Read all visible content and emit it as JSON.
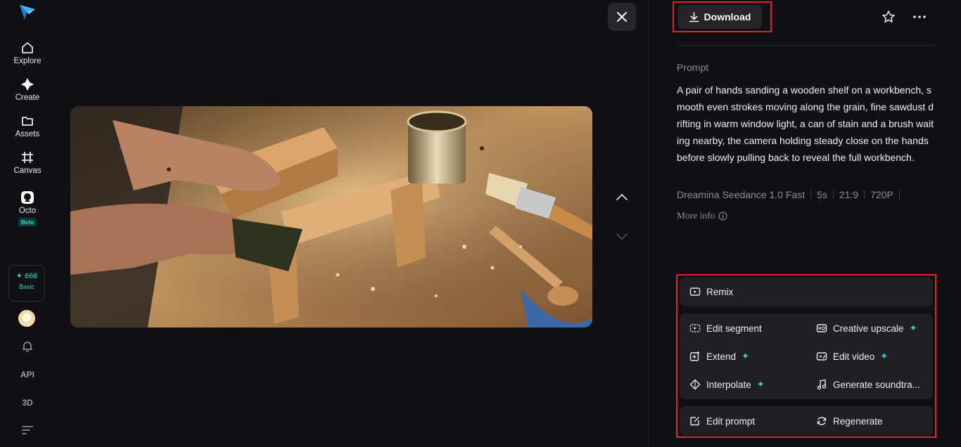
{
  "sidebar": {
    "items": [
      {
        "label": "Explore",
        "icon": "home-icon"
      },
      {
        "label": "Create",
        "icon": "sparkle-icon"
      },
      {
        "label": "Assets",
        "icon": "folder-icon"
      },
      {
        "label": "Canvas",
        "icon": "canvas-icon"
      },
      {
        "label": "Octo",
        "icon": "octo-icon",
        "badge": "Beta"
      }
    ],
    "credits": {
      "value": "666",
      "tier": "Basic"
    },
    "api_label": "API",
    "three_d_label": "3D"
  },
  "header": {
    "download_label": "Download"
  },
  "details": {
    "prompt_label": "Prompt",
    "prompt_text": "A pair of hands sanding a wooden shelf on a workbench, smooth even strokes moving along the grain, fine sawdust drifting in warm window light, a can of stain and a brush waiting nearby, the camera holding steady close on the hands before slowly pulling back to reveal the full workbench.",
    "model": "Dreamina Seedance 1.0 Fast",
    "duration": "5s",
    "ratio": "21:9",
    "resolution": "720P",
    "more_info_label": "More info"
  },
  "actions": {
    "remix": "Remix",
    "edit_segment": "Edit segment",
    "creative_upscale": "Creative upscale",
    "extend": "Extend",
    "edit_video": "Edit video",
    "interpolate": "Interpolate",
    "generate_soundtrack": "Generate soundtra...",
    "edit_prompt": "Edit prompt",
    "regenerate": "Regenerate"
  },
  "colors": {
    "accent": "#27d3c8",
    "highlight": "#e0242b",
    "background": "#101014"
  }
}
